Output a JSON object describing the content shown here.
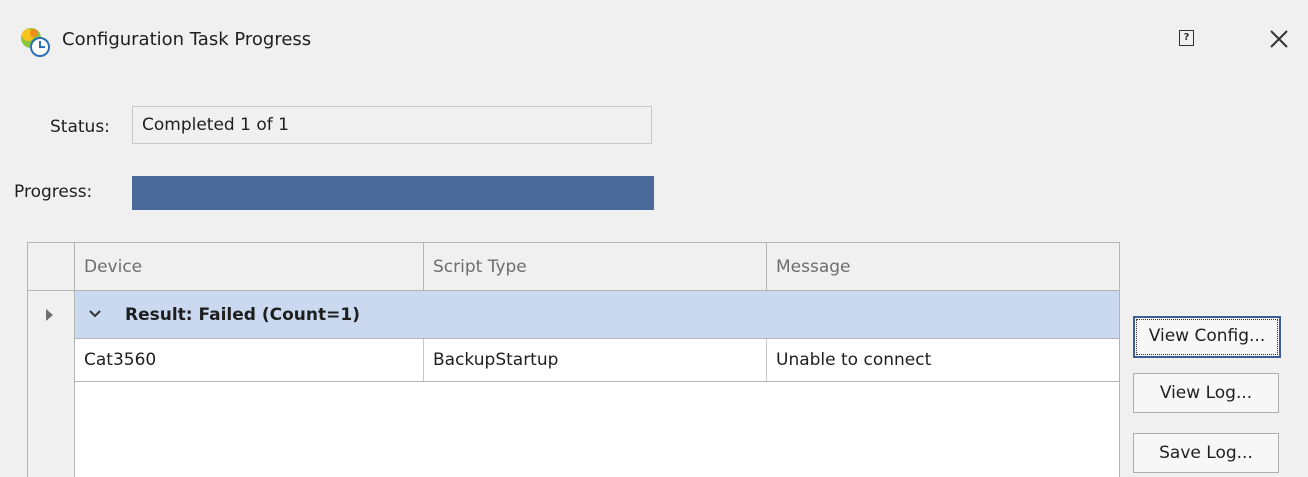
{
  "window": {
    "title": "Configuration Task Progress",
    "help_glyph": "?",
    "close_glyph": "×"
  },
  "status": {
    "label": "Status:",
    "value": "Completed 1 of 1"
  },
  "progress": {
    "label": "Progress:",
    "fraction": 1.0
  },
  "grid": {
    "columns": [
      "Device",
      "Script Type",
      "Message"
    ],
    "group": {
      "label": "Result: Failed (Count=1)"
    },
    "rows": [
      {
        "device": "Cat3560",
        "script_type": "BackupStartup",
        "message": "Unable to connect"
      }
    ]
  },
  "buttons": {
    "view_config": "View Config...",
    "view_log": "View Log...",
    "save_log": "Save Log..."
  },
  "colors": {
    "progress_fill": "#4a6b9a",
    "group_row_bg": "#cad9f0",
    "focused_button_border": "#3a5f9a"
  }
}
